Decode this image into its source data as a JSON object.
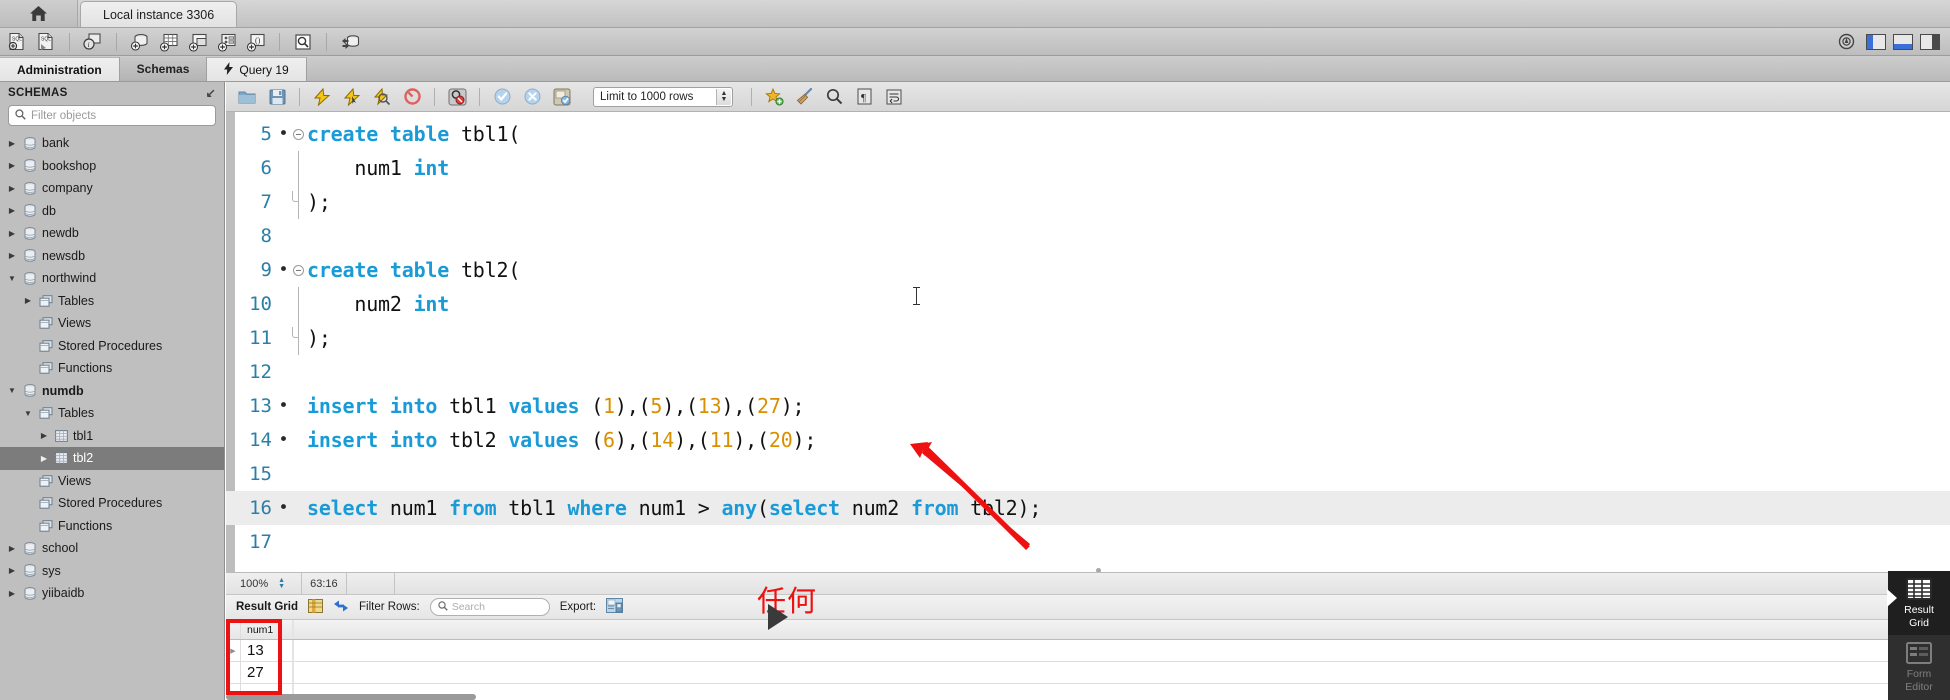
{
  "titlebar": {
    "home_icon": "home-icon",
    "connection_tab": "Local instance 3306"
  },
  "main_toolbar": {
    "buttons": [
      {
        "name": "new-sql-tab",
        "icon": "sql-new-file-icon"
      },
      {
        "name": "open-sql-script",
        "icon": "sql-open-file-icon"
      },
      {
        "name": "server-info",
        "icon": "server-info-icon"
      },
      {
        "name": "create-schema",
        "icon": "create-schema-icon"
      },
      {
        "name": "create-table",
        "icon": "create-table-icon"
      },
      {
        "name": "create-view",
        "icon": "create-view-icon"
      },
      {
        "name": "create-procedure",
        "icon": "create-procedure-icon"
      },
      {
        "name": "create-function",
        "icon": "create-function-icon"
      },
      {
        "name": "search-data",
        "icon": "search-data-icon"
      },
      {
        "name": "reconnect-server",
        "icon": "reconnect-icon"
      }
    ],
    "right": {
      "help_icon": "help-icon",
      "toggle_sidebar": "toggle-left-panel-icon",
      "toggle_output": "toggle-bottom-panel-icon",
      "toggle_secondary": "toggle-right-panel-icon"
    }
  },
  "tabs": [
    {
      "label": "Administration",
      "active": false,
      "name": "tab-administration"
    },
    {
      "label": "Schemas",
      "active": false,
      "name": "tab-schemas"
    },
    {
      "label": "Query 19",
      "active": true,
      "name": "tab-query-19",
      "icon": "lightning-icon"
    }
  ],
  "sidebar": {
    "header": "SCHEMAS",
    "collapse_icon": "collapse-icon",
    "filter": {
      "placeholder": "Filter objects",
      "value": "",
      "icon": "search-icon"
    },
    "tree": [
      {
        "label": "bank",
        "indent": 0,
        "twist": "right",
        "icon": "schema-icon"
      },
      {
        "label": "bookshop",
        "indent": 0,
        "twist": "right",
        "icon": "schema-icon"
      },
      {
        "label": "company",
        "indent": 0,
        "twist": "right",
        "icon": "schema-icon"
      },
      {
        "label": "db",
        "indent": 0,
        "twist": "right",
        "icon": "schema-icon"
      },
      {
        "label": "newdb",
        "indent": 0,
        "twist": "right",
        "icon": "schema-icon"
      },
      {
        "label": "newsdb",
        "indent": 0,
        "twist": "right",
        "icon": "schema-icon"
      },
      {
        "label": "northwind",
        "indent": 0,
        "twist": "down",
        "icon": "schema-icon"
      },
      {
        "label": "Tables",
        "indent": 1,
        "twist": "right",
        "icon": "folder-icon"
      },
      {
        "label": "Views",
        "indent": 1,
        "twist": "none",
        "icon": "folder-icon"
      },
      {
        "label": "Stored Procedures",
        "indent": 1,
        "twist": "none",
        "icon": "folder-icon"
      },
      {
        "label": "Functions",
        "indent": 1,
        "twist": "none",
        "icon": "folder-icon"
      },
      {
        "label": "numdb",
        "indent": 0,
        "twist": "down",
        "icon": "schema-icon",
        "bold": true
      },
      {
        "label": "Tables",
        "indent": 1,
        "twist": "down",
        "icon": "folder-icon"
      },
      {
        "label": "tbl1",
        "indent": 2,
        "twist": "right",
        "icon": "table-icon"
      },
      {
        "label": "tbl2",
        "indent": 2,
        "twist": "right",
        "icon": "table-icon",
        "selected": true
      },
      {
        "label": "Views",
        "indent": 1,
        "twist": "none",
        "icon": "folder-icon"
      },
      {
        "label": "Stored Procedures",
        "indent": 1,
        "twist": "none",
        "icon": "folder-icon"
      },
      {
        "label": "Functions",
        "indent": 1,
        "twist": "none",
        "icon": "folder-icon"
      },
      {
        "label": "school",
        "indent": 0,
        "twist": "right",
        "icon": "schema-icon"
      },
      {
        "label": "sys",
        "indent": 0,
        "twist": "right",
        "icon": "schema-icon"
      },
      {
        "label": "yiibaidb",
        "indent": 0,
        "twist": "right",
        "icon": "schema-icon"
      }
    ]
  },
  "sql_toolbar": {
    "buttons": [
      {
        "name": "open-script-button",
        "icon": "folder-open-icon"
      },
      {
        "name": "save-script-button",
        "icon": "save-icon"
      },
      {
        "name": "execute-statement-button",
        "icon": "lightning-bolt-icon"
      },
      {
        "name": "execute-current-statement-button",
        "icon": "lightning-cursor-icon"
      },
      {
        "name": "explain-statement-button",
        "icon": "lightning-magnifier-icon"
      },
      {
        "name": "stop-execution-button",
        "icon": "stop-icon"
      },
      {
        "name": "toggle-stop-on-error-button",
        "icon": "stop-on-error-icon"
      },
      {
        "name": "commit-button",
        "icon": "commit-check-icon"
      },
      {
        "name": "rollback-button",
        "icon": "rollback-cross-icon"
      },
      {
        "name": "autocommit-toggle-button",
        "icon": "autocommit-icon"
      }
    ],
    "limit_select": {
      "value": "Limit to 1000 rows",
      "name": "row-limit-select"
    },
    "right_buttons": [
      {
        "name": "toggle-snippets-button",
        "icon": "star-plus-icon"
      },
      {
        "name": "beautify-query-button",
        "icon": "broom-icon"
      },
      {
        "name": "find-button",
        "icon": "magnifier-icon"
      },
      {
        "name": "toggle-invisible-chars-button",
        "icon": "pilcrow-icon"
      },
      {
        "name": "toggle-wrapping-button",
        "icon": "wrap-lines-icon"
      }
    ]
  },
  "code": {
    "lines": [
      {
        "num": "5",
        "mark": true,
        "fold": "start",
        "tokens": [
          {
            "t": "create",
            "c": "kw"
          },
          {
            "t": " ",
            "c": "pl"
          },
          {
            "t": "table",
            "c": "kw"
          },
          {
            "t": " tbl1(",
            "c": "pl"
          }
        ]
      },
      {
        "num": "6",
        "mark": false,
        "fold": "mid",
        "tokens": [
          {
            "t": "    num1 ",
            "c": "pl"
          },
          {
            "t": "int",
            "c": "kw"
          }
        ]
      },
      {
        "num": "7",
        "mark": false,
        "fold": "end",
        "tokens": [
          {
            "t": ");",
            "c": "pl"
          }
        ]
      },
      {
        "num": "8",
        "mark": false,
        "fold": "none",
        "tokens": []
      },
      {
        "num": "9",
        "mark": true,
        "fold": "start",
        "tokens": [
          {
            "t": "create",
            "c": "kw"
          },
          {
            "t": " ",
            "c": "pl"
          },
          {
            "t": "table",
            "c": "kw"
          },
          {
            "t": " tbl2(",
            "c": "pl"
          }
        ]
      },
      {
        "num": "10",
        "mark": false,
        "fold": "mid",
        "tokens": [
          {
            "t": "    num2 ",
            "c": "pl"
          },
          {
            "t": "int",
            "c": "kw"
          }
        ]
      },
      {
        "num": "11",
        "mark": false,
        "fold": "end",
        "tokens": [
          {
            "t": ");",
            "c": "pl"
          }
        ]
      },
      {
        "num": "12",
        "mark": false,
        "fold": "none",
        "tokens": []
      },
      {
        "num": "13",
        "mark": true,
        "fold": "none",
        "tokens": [
          {
            "t": "insert",
            "c": "kw"
          },
          {
            "t": " ",
            "c": "pl"
          },
          {
            "t": "into",
            "c": "kw"
          },
          {
            "t": " tbl1 ",
            "c": "pl"
          },
          {
            "t": "values",
            "c": "kw"
          },
          {
            "t": " (",
            "c": "pl"
          },
          {
            "t": "1",
            "c": "num"
          },
          {
            "t": "),(",
            "c": "pl"
          },
          {
            "t": "5",
            "c": "num"
          },
          {
            "t": "),(",
            "c": "pl"
          },
          {
            "t": "13",
            "c": "num"
          },
          {
            "t": "),(",
            "c": "pl"
          },
          {
            "t": "27",
            "c": "num"
          },
          {
            "t": ");",
            "c": "pl"
          }
        ]
      },
      {
        "num": "14",
        "mark": true,
        "fold": "none",
        "tokens": [
          {
            "t": "insert",
            "c": "kw"
          },
          {
            "t": " ",
            "c": "pl"
          },
          {
            "t": "into",
            "c": "kw"
          },
          {
            "t": " tbl2 ",
            "c": "pl"
          },
          {
            "t": "values",
            "c": "kw"
          },
          {
            "t": " (",
            "c": "pl"
          },
          {
            "t": "6",
            "c": "num"
          },
          {
            "t": "),(",
            "c": "pl"
          },
          {
            "t": "14",
            "c": "num"
          },
          {
            "t": "),(",
            "c": "pl"
          },
          {
            "t": "11",
            "c": "num"
          },
          {
            "t": "),(",
            "c": "pl"
          },
          {
            "t": "20",
            "c": "num"
          },
          {
            "t": ");",
            "c": "pl"
          }
        ]
      },
      {
        "num": "15",
        "mark": false,
        "fold": "none",
        "tokens": []
      },
      {
        "num": "16",
        "mark": true,
        "fold": "none",
        "highlight": true,
        "tokens": [
          {
            "t": "select",
            "c": "kw"
          },
          {
            "t": " num1 ",
            "c": "pl"
          },
          {
            "t": "from",
            "c": "kw"
          },
          {
            "t": " tbl1 ",
            "c": "pl"
          },
          {
            "t": "where",
            "c": "kw"
          },
          {
            "t": " num1 > ",
            "c": "pl"
          },
          {
            "t": "any",
            "c": "kw"
          },
          {
            "t": "(",
            "c": "pl"
          },
          {
            "t": "select",
            "c": "kw"
          },
          {
            "t": " num2 ",
            "c": "pl"
          },
          {
            "t": "from",
            "c": "kw"
          },
          {
            "t": " tbl2);",
            "c": "pl"
          }
        ]
      },
      {
        "num": "17",
        "mark": false,
        "fold": "none",
        "tokens": []
      }
    ]
  },
  "status_line": {
    "zoom": "100%",
    "cursor_position": "63:16"
  },
  "results_bar": {
    "title": "Result Grid",
    "grid_view_icon": "grid-view-icon",
    "refresh_icon": "refresh-icon",
    "filter_label": "Filter Rows:",
    "search_placeholder": "Search",
    "search_value": "",
    "export_label": "Export:",
    "export_icon": "export-icon",
    "maximize_icon": "maximize-panel-icon"
  },
  "result_grid": {
    "columns": [
      "num1"
    ],
    "rows": [
      {
        "values": [
          "13"
        ],
        "current": true
      },
      {
        "values": [
          "27"
        ],
        "current": false
      }
    ]
  },
  "right_panel": [
    {
      "label_line1": "Result",
      "label_line2": "Grid",
      "icon": "result-grid-icon",
      "active": true,
      "name": "result-grid-tab"
    },
    {
      "label_line1": "Form",
      "label_line2": "Editor",
      "icon": "form-editor-icon",
      "active": false,
      "name": "form-editor-tab"
    }
  ],
  "annotation": {
    "chinese_text": "任何",
    "color": "#ee1111",
    "arrow_name": "red-arrow-pointing-to-any-keyword",
    "highlight_box_name": "red-box-around-result-values"
  },
  "colors": {
    "keyword": "#1a9bd7",
    "number": "#d89000",
    "line_number": "#2a7fa8",
    "annotation_red": "#ee1111",
    "selection": "#7c7c7c"
  }
}
